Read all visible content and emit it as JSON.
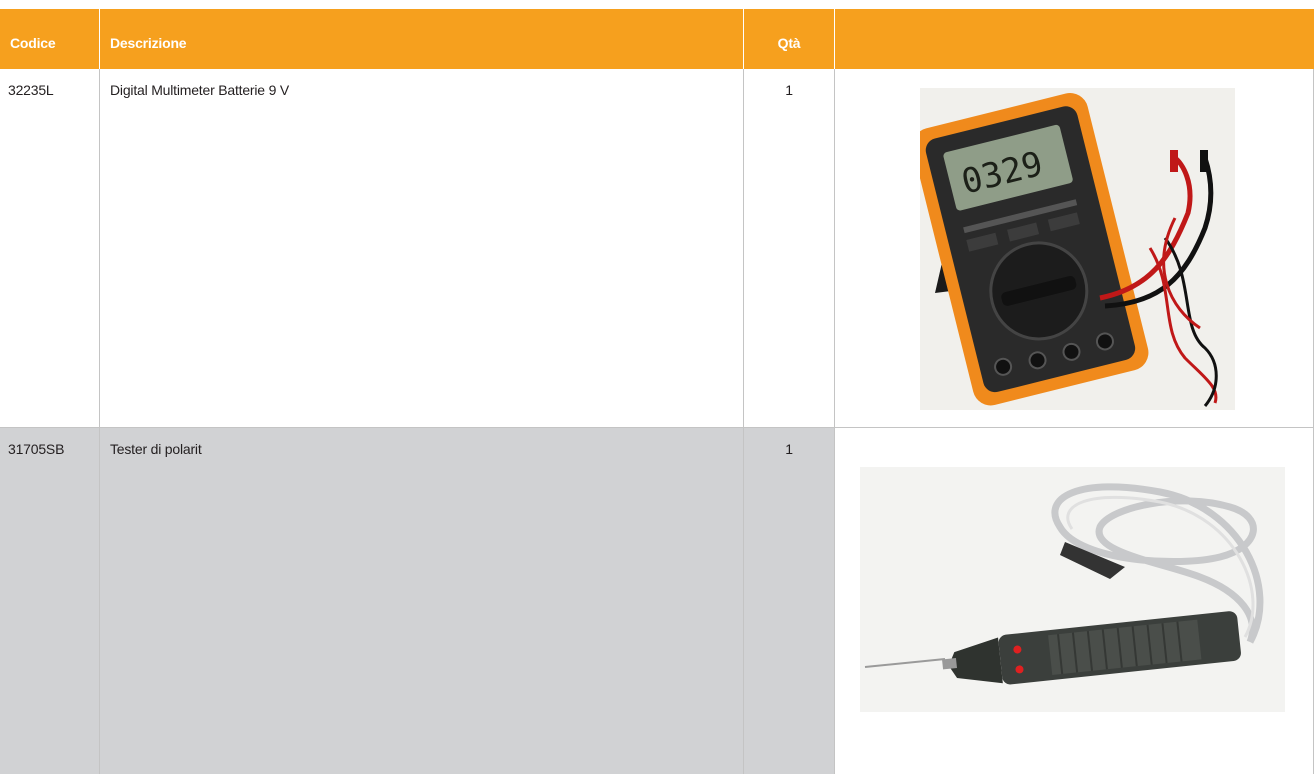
{
  "header": {
    "codice": "Codice",
    "descrizione": "Descrizione",
    "qta": "Qtà",
    "image": ""
  },
  "rows": [
    {
      "codice": "32235L",
      "descrizione": "Digital Multimeter Batterie 9 V",
      "qta": "1",
      "image_icon": "digital-multimeter-photo",
      "display_reading": "0329"
    },
    {
      "codice": "31705SB",
      "descrizione": "Tester di polarit",
      "qta": "1",
      "image_icon": "polarity-tester-photo"
    }
  ],
  "colors": {
    "header_bg": "#f6a01e",
    "row_alt_bg": "#d1d2d4",
    "grid": "#c4c4c4"
  }
}
